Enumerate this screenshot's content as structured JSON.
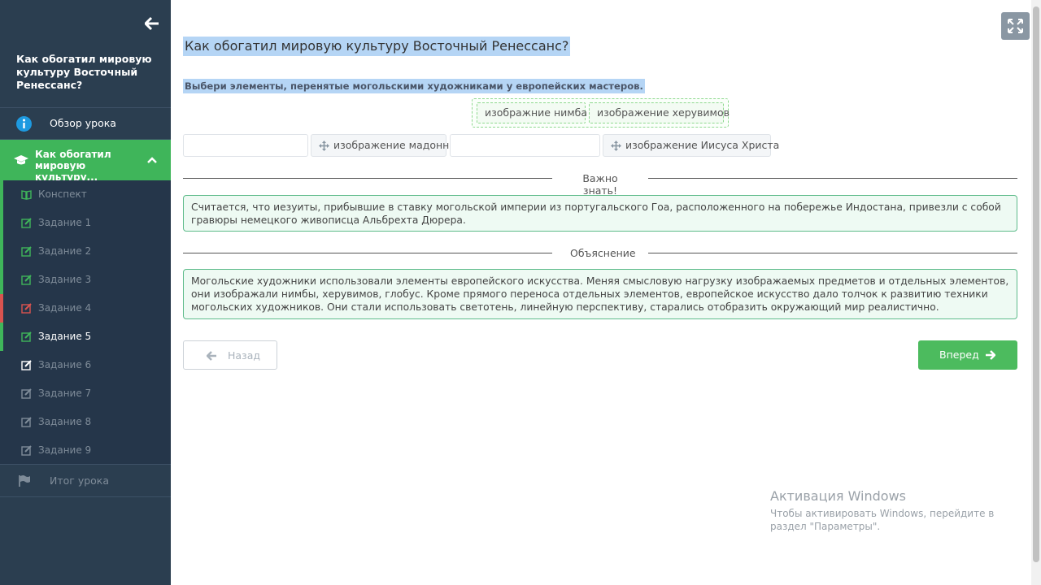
{
  "sidebar": {
    "lesson_title": "Как обогатил мировую культуру Восточный Ренессанс?",
    "overview_label": "Обзор урока",
    "active_lesson_label": "Как обогатил мировую культуру...",
    "items": [
      {
        "label": "Конспект",
        "icon": "book-icon",
        "status_color": "#3fb55a"
      },
      {
        "label": "Задание 1",
        "icon": "edit-icon",
        "status_color": "#3fb55a"
      },
      {
        "label": "Задание 2",
        "icon": "edit-icon",
        "status_color": "#3fb55a"
      },
      {
        "label": "Задание 3",
        "icon": "edit-icon",
        "status_color": "#3fb55a"
      },
      {
        "label": "Задание 4",
        "icon": "edit-icon",
        "status_color": "#d9534f"
      },
      {
        "label": "Задание 5",
        "icon": "edit-icon",
        "status_color": "#3fb55a"
      },
      {
        "label": "Задание 6",
        "icon": "edit-icon",
        "status_color": ""
      },
      {
        "label": "Задание 7",
        "icon": "edit-icon",
        "status_color": ""
      },
      {
        "label": "Задание 8",
        "icon": "edit-icon",
        "status_color": ""
      },
      {
        "label": "Задание 9",
        "icon": "edit-icon",
        "status_color": ""
      }
    ],
    "summary_label": "Итог урока"
  },
  "main": {
    "title": "Как обогатил мировую культуру Восточный Ренессанс?",
    "instruction": "Выбери элементы, перенятые могольскими художниками у европейских мастеров.",
    "bank_chips": [
      "изображние нимба",
      "изображение херувимов"
    ],
    "placed_items": [
      "изображение мадонн",
      "изображение Иисуса Христа"
    ],
    "important_heading": "Важно знать!",
    "important_text": "Считается, что иезуиты, прибывшие в ставку могольской империи из португальского Гоа, расположенного на побережье Индостана, привезли с собой гравюры немецкого живописца Альбрехта Дюрера.",
    "explanation_heading": "Объяснение",
    "explanation_text": "Могольские художники использовали элементы европейского искусства. Меняя смысловую нагрузку изображаемых предметов и отдельных элементов, они изображали нимбы, херувимов, глобус. Кроме прямого переноса отдельных элементов, европейское искусство дало толчок к развитию техники могольских художников. Они стали использовать светотень, линейную перспективу, старались отобразить окружающий мир реалистично.",
    "back_label": "Назад",
    "next_label": "Вперед"
  },
  "windows_activation": {
    "title": "Активация Windows",
    "text": "Чтобы активировать Windows, перейдите в раздел \"Параметры\"."
  },
  "colors": {
    "sidebar_bg": "#2b3e50",
    "accent_green": "#3fb55a",
    "error_red": "#d9534f",
    "selection_blue": "#b5d5f5"
  }
}
